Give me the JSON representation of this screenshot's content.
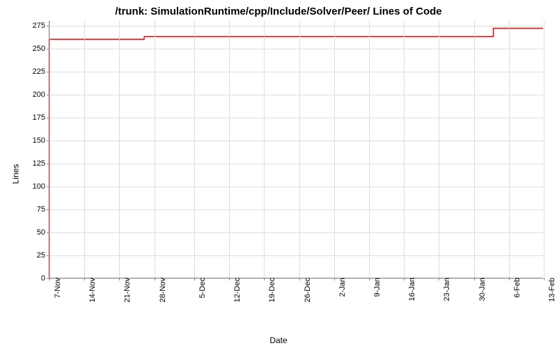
{
  "chart_data": {
    "type": "line",
    "title": "/trunk: SimulationRuntime/cpp/Include/Solver/Peer/ Lines of Code",
    "xlabel": "Date",
    "ylabel": "Lines",
    "ylim": [
      0,
      280
    ],
    "y_ticks": [
      0,
      25,
      50,
      75,
      100,
      125,
      150,
      175,
      200,
      225,
      250,
      275
    ],
    "x_categories": [
      "7-Nov",
      "14-Nov",
      "21-Nov",
      "28-Nov",
      "5-Dec",
      "12-Dec",
      "19-Dec",
      "26-Dec",
      "2-Jan",
      "9-Jan",
      "16-Jan",
      "23-Jan",
      "30-Jan",
      "6-Feb",
      "13-Feb"
    ],
    "series": [
      {
        "name": "Lines of Code",
        "color": "#e00",
        "points": [
          {
            "x": "7-Nov",
            "y": 0
          },
          {
            "x": "7-Nov",
            "y": 260
          },
          {
            "x": "26-Nov",
            "y": 260
          },
          {
            "x": "26-Nov",
            "y": 263
          },
          {
            "x": "3-Feb",
            "y": 263
          },
          {
            "x": "3-Feb",
            "y": 272
          },
          {
            "x": "13-Feb",
            "y": 272
          }
        ]
      }
    ]
  }
}
